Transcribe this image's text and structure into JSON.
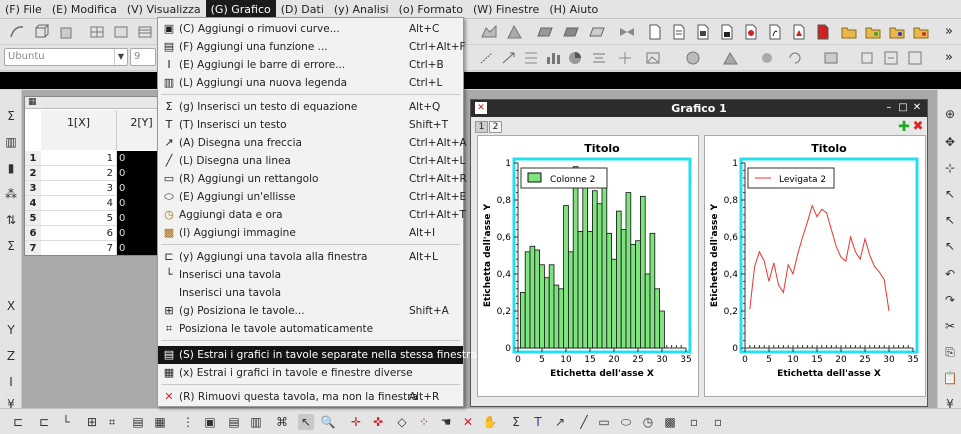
{
  "menubar": [
    {
      "label": "(F) File"
    },
    {
      "label": "(E) Modifica"
    },
    {
      "label": "(V) Visualizza"
    },
    {
      "label": "(G) Grafico"
    },
    {
      "label": "(D) Dati"
    },
    {
      "label": "(y) Analisi"
    },
    {
      "label": "(o) Formato"
    },
    {
      "label": "(W) Finestre"
    },
    {
      "label": "(H) Aiuto"
    }
  ],
  "toolbar": {
    "font_combo": "Ubuntu",
    "size_combo": "9",
    "overflow": "»"
  },
  "graph_menu": {
    "items": [
      {
        "label": "(C) Aggiungi o rimuovi curve...",
        "shortcut": "Alt+C",
        "icon": "curves-icon"
      },
      {
        "label": "(F) Aggiungi una funzione ...",
        "shortcut": "Ctrl+Alt+F",
        "icon": "function-icon"
      },
      {
        "label": "(E) Aggiungi le barre di errore...",
        "shortcut": "Ctrl+B",
        "icon": "error-bars-icon"
      },
      {
        "label": "(L) Aggiungi una nuova legenda",
        "shortcut": "Ctrl+L",
        "icon": "legend-icon"
      },
      {
        "label": "(g) Inserisci un testo di equazione",
        "shortcut": "Alt+Q",
        "icon": "sigma-icon"
      },
      {
        "label": "(T) Inserisci un testo",
        "shortcut": "Shift+T",
        "icon": "text-icon"
      },
      {
        "label": "(A) Disegna una freccia",
        "shortcut": "Ctrl+Alt+A",
        "icon": "arrow-icon"
      },
      {
        "label": "(L) Disegna una linea",
        "shortcut": "Ctrl+Alt+L",
        "icon": "line-icon"
      },
      {
        "label": "(R) Aggiungi un rettangolo",
        "shortcut": "Ctrl+Alt+R",
        "icon": "rectangle-icon"
      },
      {
        "label": "(E) Aggiungi un'ellisse",
        "shortcut": "Ctrl+Alt+E",
        "icon": "ellipse-icon"
      },
      {
        "label": "Aggiungi data e ora",
        "shortcut": "Ctrl+Alt+T",
        "icon": "clock-icon"
      },
      {
        "label": "(I) Aggiungi immagine",
        "shortcut": "Alt+I",
        "icon": "image-icon"
      },
      {
        "label": "(y) Aggiungi una tavola alla finestra",
        "shortcut": "Alt+L",
        "icon": "add-layer-icon"
      },
      {
        "label": "Inserisci una tavola",
        "shortcut": "",
        "icon": "insert-layer-icon"
      },
      {
        "label": "Inserisci una tavola",
        "shortcut": "",
        "icon": ""
      },
      {
        "label": "(g) Posiziona le tavole...",
        "shortcut": "Shift+A",
        "icon": "arrange-layers-icon"
      },
      {
        "label": "Posiziona le tavole automaticamente",
        "shortcut": "",
        "icon": "auto-arrange-icon"
      },
      {
        "label": "(S) Estrai i grafici in tavole separate nella stessa finestra",
        "shortcut": "",
        "icon": "extract-layers-icon"
      },
      {
        "label": "(x) Estrai i grafici in tavole e finestre diverse",
        "shortcut": "",
        "icon": "extract-windows-icon"
      },
      {
        "label": "(R) Rimuovi questa tavola, ma non la finestra",
        "shortcut": "Alt+R",
        "icon": "remove-layer-icon"
      }
    ]
  },
  "table": {
    "columns": [
      "1[X]",
      "2[Y]"
    ],
    "rows": [
      {
        "n": "1",
        "x": "1",
        "y": "0"
      },
      {
        "n": "2",
        "x": "2",
        "y": "0"
      },
      {
        "n": "3",
        "x": "3",
        "y": "0"
      },
      {
        "n": "4",
        "x": "4",
        "y": "0"
      },
      {
        "n": "5",
        "x": "5",
        "y": "0"
      },
      {
        "n": "6",
        "x": "6",
        "y": "0"
      },
      {
        "n": "7",
        "x": "7",
        "y": "0"
      }
    ]
  },
  "graph_window": {
    "title": "Grafico 1",
    "layers": [
      "1",
      "2"
    ],
    "colors": {
      "frame": "#22e0f0",
      "bars": "#7ee37e",
      "line": "#ee3333",
      "title_bar": "#2c2c2c"
    }
  },
  "chart_data": [
    {
      "type": "bar",
      "title": "Titolo",
      "xlabel": "Etichetta dell'asse X",
      "ylabel": "Etichetta dell'asse Y",
      "xlim": [
        0,
        35
      ],
      "ylim": [
        0,
        1
      ],
      "xticks": [
        "0",
        "5",
        "10",
        "15",
        "20",
        "25",
        "30",
        "35"
      ],
      "yticks": [
        "0",
        "0,2",
        "0,4",
        "0,6",
        "0,8",
        "1"
      ],
      "series": [
        {
          "name": "Colonne 2",
          "x": [
            1,
            2,
            3,
            4,
            5,
            6,
            7,
            8,
            9,
            10,
            11,
            12,
            13,
            14,
            15,
            16,
            17,
            18,
            19,
            20,
            21,
            22,
            23,
            24,
            25,
            26,
            27,
            28,
            29,
            30
          ],
          "values": [
            0.3,
            0.52,
            0.55,
            0.53,
            0.45,
            0.38,
            0.45,
            0.34,
            0.32,
            0.77,
            0.52,
            0.98,
            0.63,
            0.95,
            0.63,
            0.85,
            0.78,
            0.89,
            0.62,
            0.48,
            0.74,
            0.64,
            0.84,
            0.56,
            0.58,
            0.82,
            0.4,
            0.62,
            0.32,
            0.2
          ]
        }
      ]
    },
    {
      "type": "line",
      "title": "Titolo",
      "xlabel": "Etichetta dell'asse X",
      "ylabel": "Etichetta dell'asse Y",
      "xlim": [
        0,
        35
      ],
      "ylim": [
        0,
        1
      ],
      "xticks": [
        "0",
        "5",
        "10",
        "15",
        "20",
        "25",
        "30",
        "35"
      ],
      "yticks": [
        "0",
        "0,2",
        "0,4",
        "0,6",
        "0,8",
        "1"
      ],
      "series": [
        {
          "name": "Levigata 2",
          "x": [
            1,
            2,
            3,
            4,
            5,
            6,
            7,
            8,
            9,
            10,
            11,
            12,
            13,
            14,
            15,
            16,
            17,
            18,
            19,
            20,
            21,
            22,
            23,
            24,
            25,
            26,
            27,
            28,
            29,
            30
          ],
          "values": [
            0.21,
            0.44,
            0.52,
            0.47,
            0.36,
            0.46,
            0.34,
            0.3,
            0.45,
            0.4,
            0.51,
            0.6,
            0.68,
            0.77,
            0.71,
            0.75,
            0.73,
            0.64,
            0.55,
            0.49,
            0.47,
            0.6,
            0.52,
            0.48,
            0.59,
            0.5,
            0.44,
            0.41,
            0.37,
            0.2
          ]
        }
      ]
    }
  ]
}
